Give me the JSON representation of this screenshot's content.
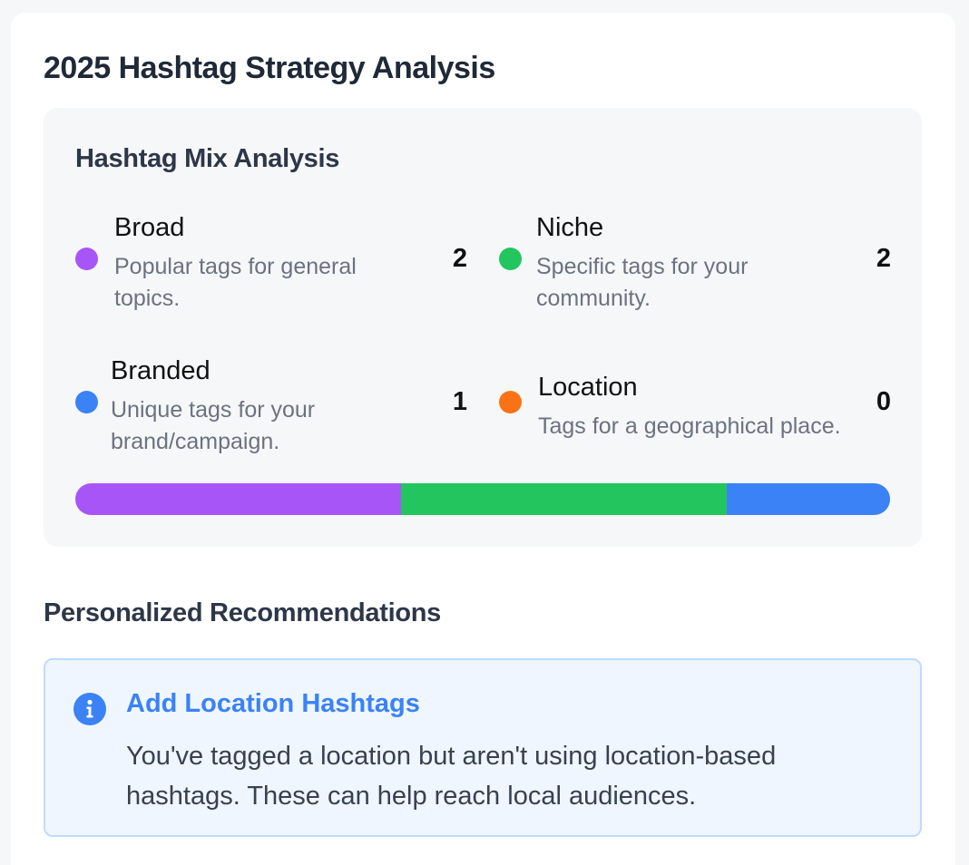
{
  "page": {
    "title": "2025 Hashtag Strategy Analysis"
  },
  "mix": {
    "title": "Hashtag Mix Analysis",
    "categories": [
      {
        "name": "Broad",
        "description": "Popular tags for general topics.",
        "count": "2",
        "value": 2,
        "color": "#a855f7"
      },
      {
        "name": "Niche",
        "description": "Specific tags for your community.",
        "count": "2",
        "value": 2,
        "color": "#22c55e"
      },
      {
        "name": "Branded",
        "description": "Unique tags for your brand/campaign.",
        "count": "1",
        "value": 1,
        "color": "#3b82f6"
      },
      {
        "name": "Location",
        "description": "Tags for a geographical place.",
        "count": "0",
        "value": 0,
        "color": "#f97316"
      }
    ]
  },
  "recommendations": {
    "title": "Personalized Recommendations",
    "items": [
      {
        "icon": "info-icon",
        "heading": "Add Location Hashtags",
        "body": "You've tagged a location but aren't using location-based hashtags. These can help reach local audiences.",
        "accent": "#3b82f6"
      }
    ]
  }
}
